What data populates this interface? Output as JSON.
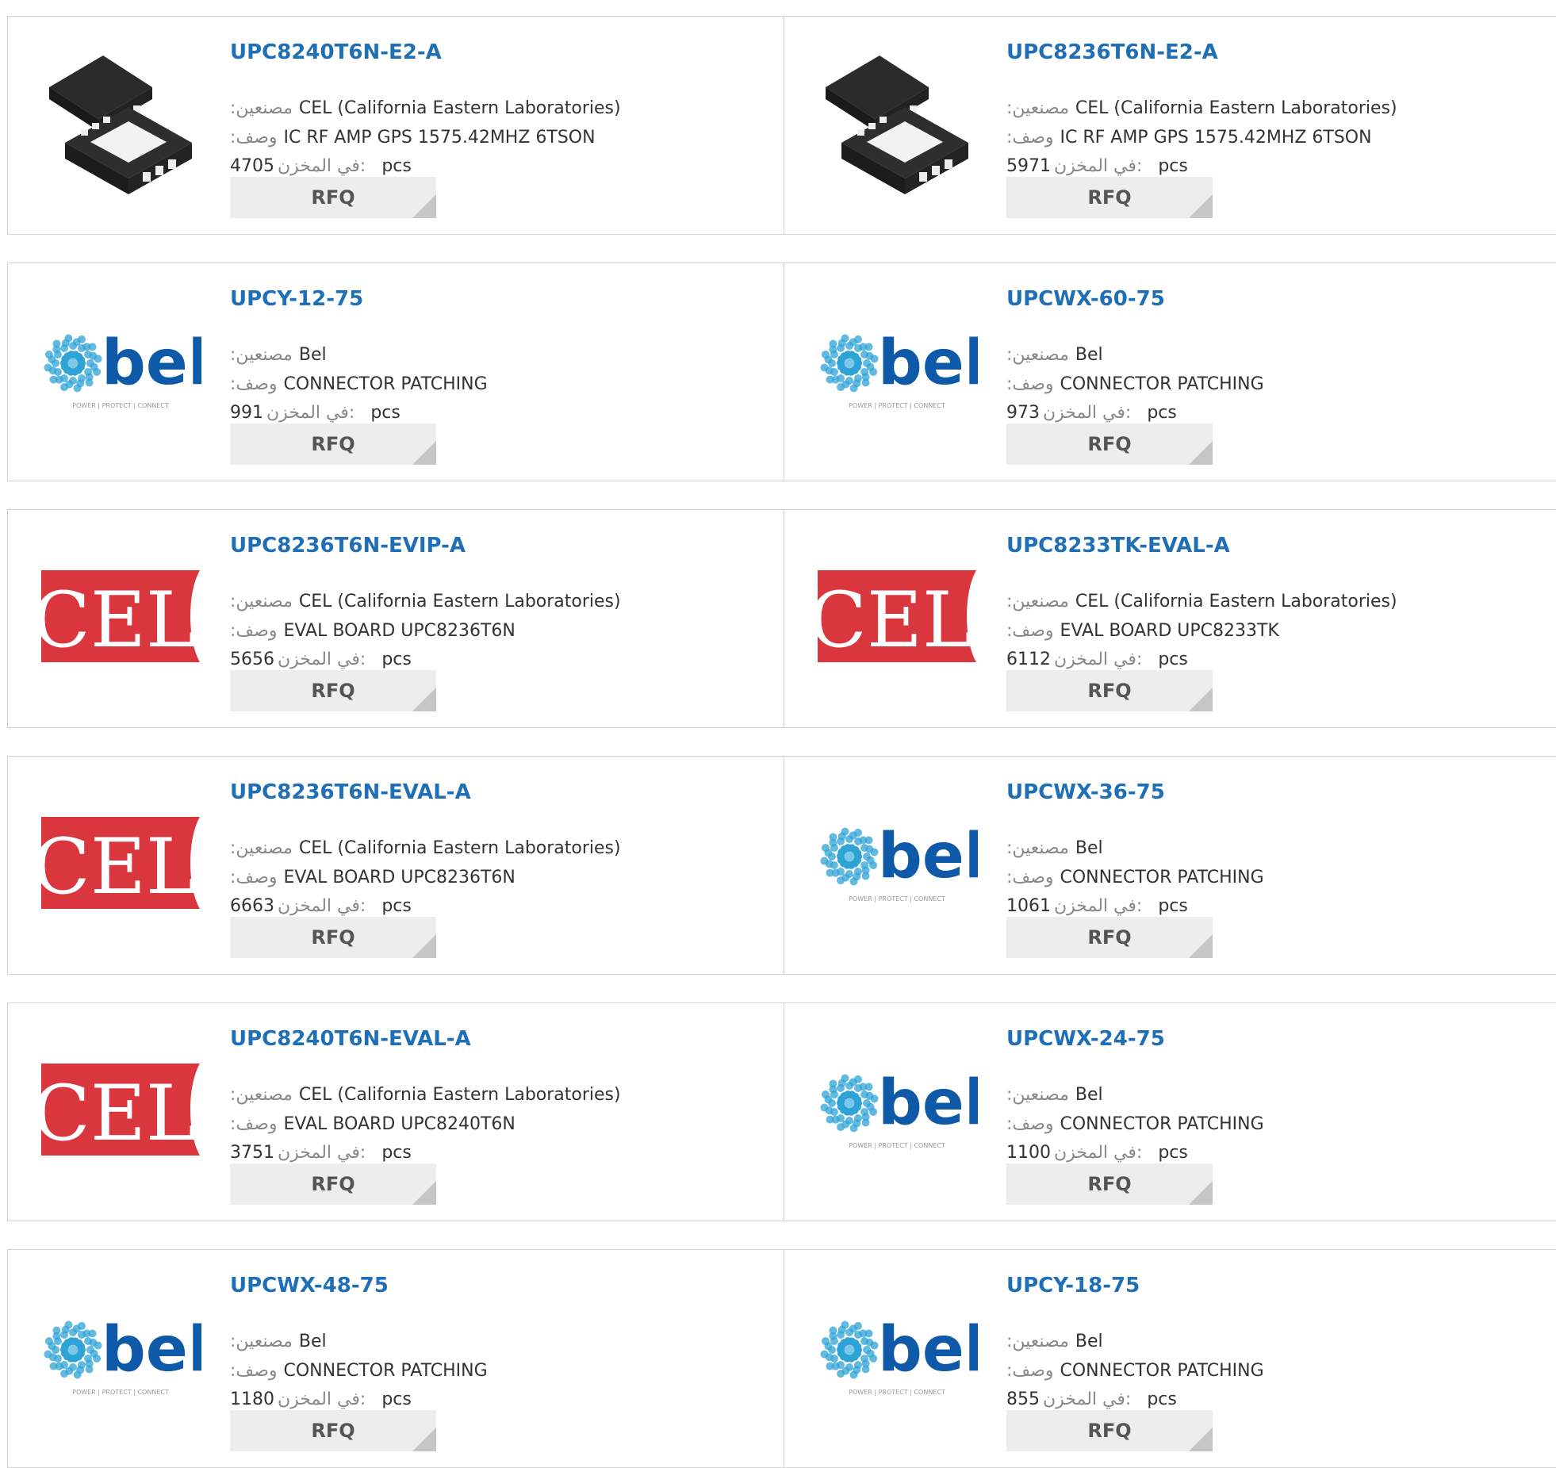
{
  "labels": {
    "manufacturer": ":مصنعين",
    "description": ":وصف",
    "stock": "في المخزن:",
    "unit": "pcs",
    "rfq": "RFQ"
  },
  "colors": {
    "link": "#1f6fb6",
    "cel_red": "#d9363e",
    "bel_blue": "#2ea3d6",
    "bel_dark": "#0f5aa8"
  },
  "products": [
    {
      "pn": "UPC8240T6N-E2-A",
      "mfr": "CEL (California Eastern Laboratories)",
      "desc": "IC RF AMP GPS 1575.42MHZ 6TSON",
      "stock": "4705",
      "image": "chip-package-icon"
    },
    {
      "pn": "UPC8236T6N-E2-A",
      "mfr": "CEL (California Eastern Laboratories)",
      "desc": "IC RF AMP GPS 1575.42MHZ 6TSON",
      "stock": "5971",
      "image": "chip-package-icon"
    },
    {
      "pn": "UPCY-12-75",
      "mfr": "Bel",
      "desc": "CONNECTOR PATCHING",
      "stock": "991",
      "image": "bel-logo"
    },
    {
      "pn": "UPCWX-60-75",
      "mfr": "Bel",
      "desc": "CONNECTOR PATCHING",
      "stock": "973",
      "image": "bel-logo"
    },
    {
      "pn": "UPC8236T6N-EVIP-A",
      "mfr": "CEL (California Eastern Laboratories)",
      "desc": "EVAL BOARD UPC8236T6N",
      "stock": "5656",
      "image": "cel-logo"
    },
    {
      "pn": "UPC8233TK-EVAL-A",
      "mfr": "CEL (California Eastern Laboratories)",
      "desc": "EVAL BOARD UPC8233TK",
      "stock": "6112",
      "image": "cel-logo"
    },
    {
      "pn": "UPC8236T6N-EVAL-A",
      "mfr": "CEL (California Eastern Laboratories)",
      "desc": "EVAL BOARD UPC8236T6N",
      "stock": "6663",
      "image": "cel-logo"
    },
    {
      "pn": "UPCWX-36-75",
      "mfr": "Bel",
      "desc": "CONNECTOR PATCHING",
      "stock": "1061",
      "image": "bel-logo"
    },
    {
      "pn": "UPC8240T6N-EVAL-A",
      "mfr": "CEL (California Eastern Laboratories)",
      "desc": "EVAL BOARD UPC8240T6N",
      "stock": "3751",
      "image": "cel-logo"
    },
    {
      "pn": "UPCWX-24-75",
      "mfr": "Bel",
      "desc": "CONNECTOR PATCHING",
      "stock": "1100",
      "image": "bel-logo"
    },
    {
      "pn": "UPCWX-48-75",
      "mfr": "Bel",
      "desc": "CONNECTOR PATCHING",
      "stock": "1180",
      "image": "bel-logo"
    },
    {
      "pn": "UPCY-18-75",
      "mfr": "Bel",
      "desc": "CONNECTOR PATCHING",
      "stock": "855",
      "image": "bel-logo"
    }
  ],
  "logos": {
    "cel_text": "CEL",
    "bel_text": "bel",
    "bel_tagline": "POWER | PROTECT | CONNECT"
  }
}
